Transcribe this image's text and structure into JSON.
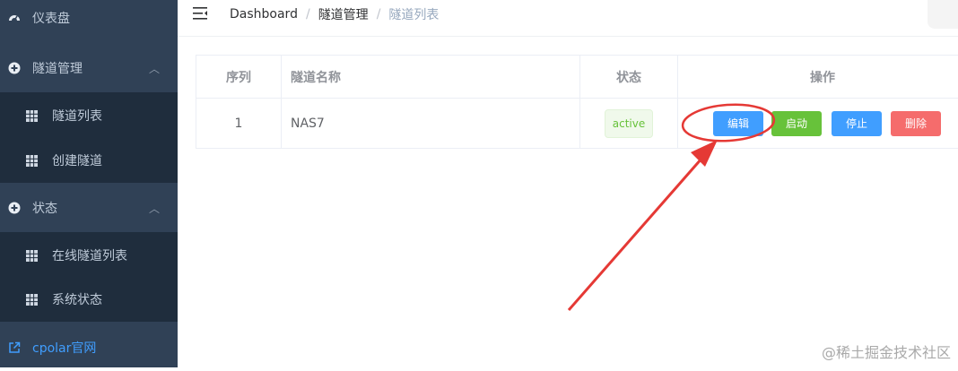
{
  "sidebar": {
    "dashboard": "仪表盘",
    "tunnel_mgmt": "隧道管理",
    "tunnel_list": "隧道列表",
    "create_tunnel": "创建隧道",
    "status": "状态",
    "online_tunnels": "在线隧道列表",
    "system_status": "系统状态",
    "cpolar_site": "cpolar官网"
  },
  "breadcrumb": {
    "home": "Dashboard",
    "level1": "隧道管理",
    "current": "隧道列表",
    "separator": "/"
  },
  "table": {
    "headers": [
      "序列",
      "隧道名称",
      "状态",
      "操作"
    ],
    "rows": [
      {
        "index": "1",
        "name": "NAS7",
        "status": "active"
      }
    ],
    "actions": {
      "edit": "编辑",
      "start": "启动",
      "stop": "停止",
      "delete": "删除"
    }
  },
  "watermark": "@稀土掘金技术社区",
  "colors": {
    "sidebar_bg": "#304156",
    "submenu_bg": "#1f2d3d",
    "primary": "#409eff",
    "success": "#67c23a",
    "danger": "#f56c6c",
    "annotation": "#e53935"
  }
}
